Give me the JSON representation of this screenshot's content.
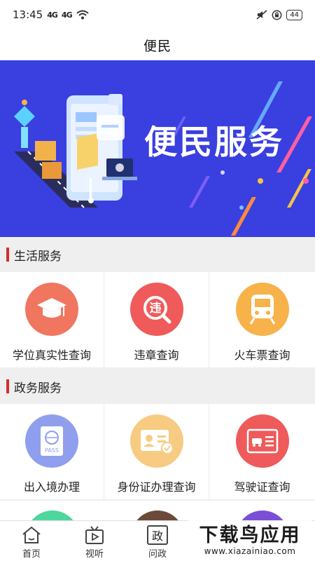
{
  "status_bar": {
    "time": "13:45",
    "signal1": "4G",
    "signal2": "4G",
    "battery": "44"
  },
  "nav": {
    "title": "便民"
  },
  "banner": {
    "title": "便民服务"
  },
  "sections": [
    {
      "label": "生活服务",
      "items": [
        {
          "label": "学位真实性查询",
          "icon": "graduation-cap-icon",
          "color": "#f0765f"
        },
        {
          "label": "违章查询",
          "icon": "traffic-violation-icon",
          "color": "#ef5a5a"
        },
        {
          "label": "火车票查询",
          "icon": "train-icon",
          "color": "#f7b24a"
        }
      ]
    },
    {
      "label": "政务服务",
      "items": [
        {
          "label": "出入境办理",
          "icon": "passport-icon",
          "color": "#8f9fed"
        },
        {
          "label": "身份证办理查询",
          "icon": "id-card-icon",
          "color": "#f8cb82"
        },
        {
          "label": "驾驶证查询",
          "icon": "driver-license-icon",
          "color": "#ef5a5a"
        }
      ]
    }
  ],
  "partial_row_colors": [
    "#4fd69c",
    "#6b4a3a",
    "#7a4fd6"
  ],
  "tabs": [
    {
      "label": "首页",
      "icon": "home-icon"
    },
    {
      "label": "视听",
      "icon": "tv-icon"
    },
    {
      "label": "问政",
      "icon": "zheng-icon",
      "glyph": "政"
    }
  ],
  "watermark": {
    "main": "下载鸟应用",
    "url": "www.xiazainiao.com"
  },
  "colors": {
    "accent": "#d82c2c",
    "banner_bg": "#3a3fe0"
  }
}
